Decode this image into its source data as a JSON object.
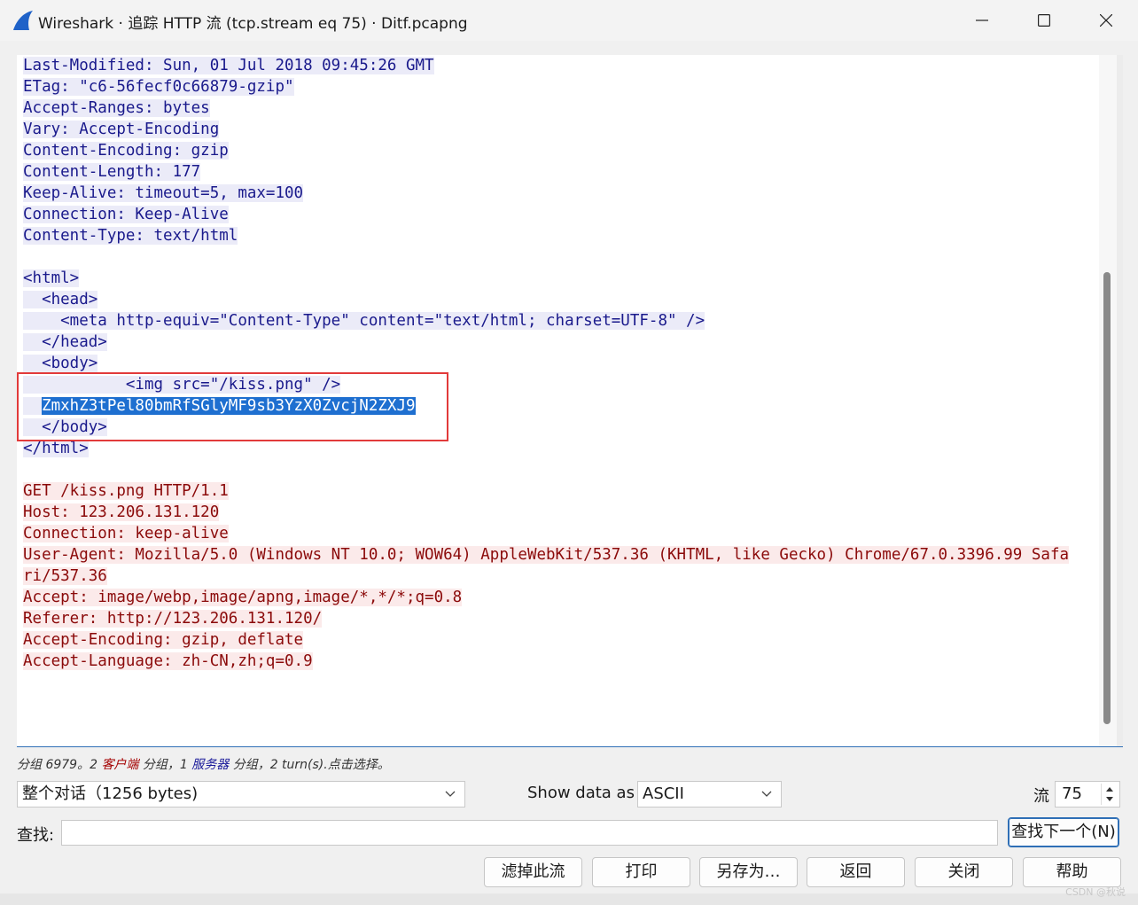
{
  "window": {
    "title": "Wireshark · 追踪 HTTP 流 (tcp.stream eq 75) · Ditf.pcapng"
  },
  "stream": {
    "lines": [
      {
        "side": "server",
        "text": "Last-Modified: Sun, 01 Jul 2018 09:45:26 GMT"
      },
      {
        "side": "server",
        "text": "ETag: \"c6-56fecf0c66879-gzip\""
      },
      {
        "side": "server",
        "text": "Accept-Ranges: bytes"
      },
      {
        "side": "server",
        "text": "Vary: Accept-Encoding"
      },
      {
        "side": "server",
        "text": "Content-Encoding: gzip"
      },
      {
        "side": "server",
        "text": "Content-Length: 177"
      },
      {
        "side": "server",
        "text": "Keep-Alive: timeout=5, max=100"
      },
      {
        "side": "server",
        "text": "Connection: Keep-Alive"
      },
      {
        "side": "server",
        "text": "Content-Type: text/html"
      },
      {
        "side": "server",
        "text": ""
      },
      {
        "side": "server",
        "text": "<html>"
      },
      {
        "side": "server",
        "text": "  <head>"
      },
      {
        "side": "server",
        "text": "    <meta http-equiv=\"Content-Type\" content=\"text/html; charset=UTF-8\" />"
      },
      {
        "side": "server",
        "text": "  </head>"
      },
      {
        "side": "server",
        "text": "  <body>"
      },
      {
        "side": "server",
        "text": "           <img src=\"/kiss.png\" />"
      },
      {
        "side": "server",
        "text": "  ",
        "selected": "ZmxhZ3tPel80bmRfSGlyMF9sb3YzX0ZvcjN2ZXJ9"
      },
      {
        "side": "server",
        "text": "  </body>"
      },
      {
        "side": "server",
        "text": "</html>"
      },
      {
        "side": "server",
        "text": ""
      },
      {
        "side": "client",
        "text": "GET /kiss.png HTTP/1.1"
      },
      {
        "side": "client",
        "text": "Host: 123.206.131.120"
      },
      {
        "side": "client",
        "text": "Connection: keep-alive"
      },
      {
        "side": "client",
        "text": "User-Agent: Mozilla/5.0 (Windows NT 10.0; WOW64) AppleWebKit/537.36 (KHTML, like Gecko) Chrome/67.0.3396.99 Safa"
      },
      {
        "side": "client",
        "text": "ri/537.36"
      },
      {
        "side": "client",
        "text": "Accept: image/webp,image/apng,image/*,*/*;q=0.8"
      },
      {
        "side": "client",
        "text": "Referer: http://123.206.131.120/"
      },
      {
        "side": "client",
        "text": "Accept-Encoding: gzip, deflate"
      },
      {
        "side": "client",
        "text": "Accept-Language: zh-CN,zh;q=0.9"
      }
    ]
  },
  "status": {
    "part1": "分组 6979。2 ",
    "client": "客户端",
    "part2": " 分组，1 ",
    "server": "服务器",
    "part3": " 分组，2 turn(s).点击选择。"
  },
  "controls": {
    "conversation_value": "整个对话（1256 bytes)",
    "show_data_label": "Show data as",
    "show_data_value": "ASCII",
    "stream_label": "流",
    "stream_value": "75",
    "find_label": "查找:",
    "find_value": "",
    "find_next_label": "查找下一个(N)"
  },
  "buttons": {
    "filter_out": "滤掉此流",
    "print": "打印",
    "save_as": "另存为…",
    "back": "返回",
    "close": "关闭",
    "help": "帮助"
  },
  "watermark": "CSDN @秋说",
  "colors": {
    "server_text": "#1a1a8c",
    "server_bg": "#ebebf8",
    "client_text": "#8b0a0a",
    "client_bg": "#fbeaea",
    "selection": "#1e6fd0",
    "annotation_box": "#e23a3a"
  }
}
